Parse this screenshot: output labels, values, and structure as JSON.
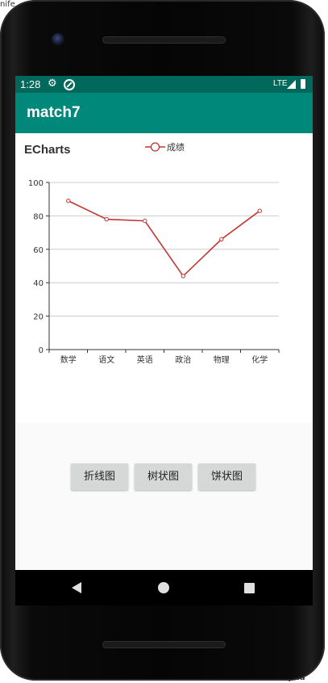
{
  "background": {
    "top_left_text": "nife",
    "left_edge_text": "e",
    "bottom_right_text": "eam Upda"
  },
  "status_bar": {
    "time": "1:28",
    "network_label": "LTE",
    "icons": [
      "gear-icon",
      "do-not-disturb-icon",
      "signal-icon",
      "battery-icon"
    ]
  },
  "app_bar": {
    "title": "match7"
  },
  "chart_data": {
    "type": "line",
    "title": "ECharts",
    "legend": [
      "成绩"
    ],
    "categories": [
      "数学",
      "语文",
      "英语",
      "政治",
      "物理",
      "化学"
    ],
    "series": [
      {
        "name": "成绩",
        "values": [
          89,
          78,
          77,
          44,
          66,
          83
        ],
        "color": "#c23531"
      }
    ],
    "yticks": [
      "0",
      "20",
      "40",
      "60",
      "80",
      "100"
    ],
    "ylim": [
      0,
      100
    ],
    "grid": true,
    "legend_position": "top-center"
  },
  "buttons": [
    {
      "label": "折线图"
    },
    {
      "label": "树状图"
    },
    {
      "label": "饼状图"
    }
  ],
  "nav_bar": {
    "icons": [
      "back-icon",
      "home-icon",
      "recents-icon"
    ]
  }
}
